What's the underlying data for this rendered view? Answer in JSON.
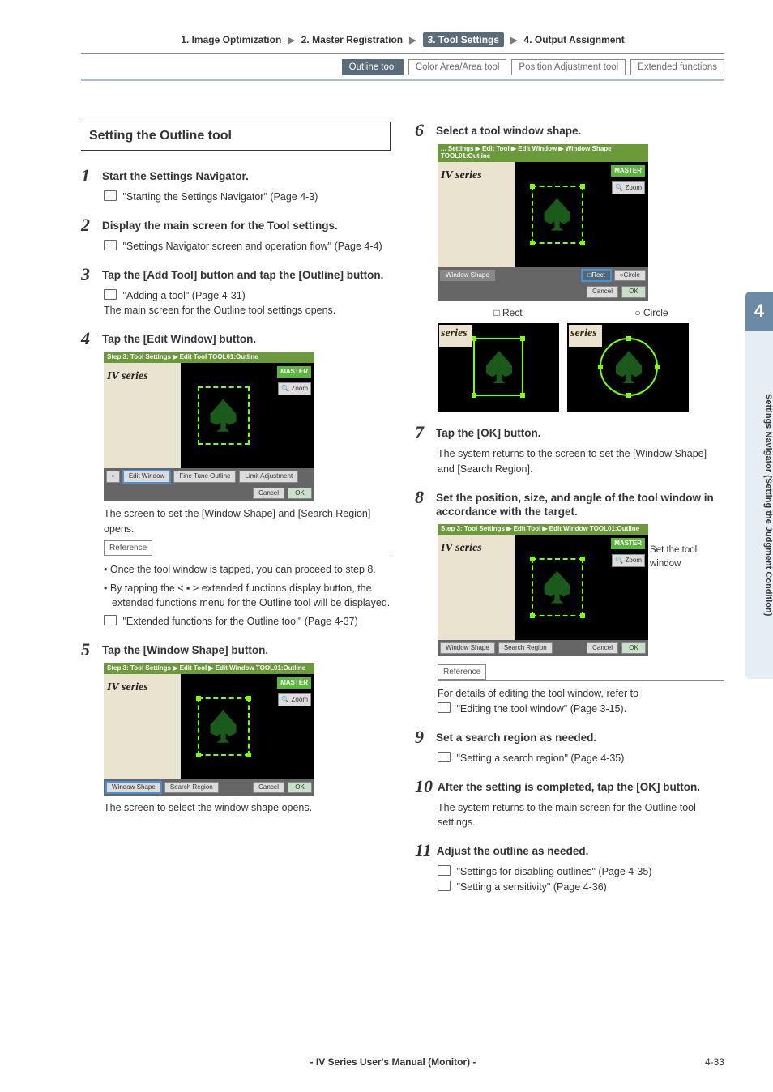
{
  "breadcrumb": {
    "items": [
      {
        "label": "1. Image Optimization"
      },
      {
        "label": "2. Master Registration"
      },
      {
        "label": "3. Tool Settings",
        "active": true
      },
      {
        "label": "4. Output Assignment"
      }
    ]
  },
  "subnav": {
    "items": [
      {
        "label": "Outline tool",
        "active": true
      },
      {
        "label": "Color Area/Area tool"
      },
      {
        "label": "Position Adjustment tool"
      },
      {
        "label": "Extended functions"
      }
    ]
  },
  "section_heading": "Setting the Outline tool",
  "steps": {
    "s1": {
      "num": "1",
      "title": "Start the Settings Navigator.",
      "ref": "\"Starting the Settings Navigator\" (Page 4-3)"
    },
    "s2": {
      "num": "2",
      "title": "Display the main screen for the Tool settings.",
      "ref": "\"Settings Navigator screen and operation flow\" (Page 4-4)"
    },
    "s3": {
      "num": "3",
      "title": "Tap the [Add Tool] button and tap the [Outline] button.",
      "ref": "\"Adding a tool\" (Page 4-31)",
      "desc": "The main screen for the Outline tool settings opens."
    },
    "s4": {
      "num": "4",
      "title": "Tap the [Edit Window] button.",
      "after": "The screen to set the [Window Shape] and [Search Region] opens.",
      "reference_label": "Reference",
      "bullets": [
        "Once the tool window is tapped, you can proceed to step 8.",
        "By tapping the < ▪ > extended functions display button, the extended functions menu for the Outline tool will be displayed."
      ],
      "ref2": "\"Extended functions for the Outline tool\" (Page 4-37)"
    },
    "s5": {
      "num": "5",
      "title": "Tap the [Window Shape] button.",
      "after": "The screen to select the window shape opens."
    },
    "s6": {
      "num": "6",
      "title": "Select a tool window shape.",
      "rect_label": "□ Rect",
      "circle_label": "○ Circle"
    },
    "s7": {
      "num": "7",
      "title": "Tap the [OK] button.",
      "desc": "The system returns to the screen to set the [Window Shape] and [Search Region]."
    },
    "s8": {
      "num": "8",
      "title": "Set the position, size, and angle of the tool window in accordance with the target.",
      "annotation": "Set the tool window",
      "reference_label": "Reference",
      "desc": "For details of editing the tool window, refer to",
      "ref": "\"Editing the tool window\" (Page 3-15)."
    },
    "s9": {
      "num": "9",
      "title": "Set a search region as needed.",
      "ref": "\"Setting a search region\" (Page 4-35)"
    },
    "s10": {
      "num": "10",
      "title": "After the setting is completed, tap the [OK] button.",
      "desc": "The system returns to the main screen for the Outline tool settings."
    },
    "s11": {
      "num": "11",
      "title": "Adjust the outline as needed.",
      "ref1": "\"Settings for disabling outlines\" (Page 4-35)",
      "ref2": "\"Setting a sensitivity\" (Page 4-36)"
    }
  },
  "screenshots": {
    "s4": {
      "topbar": "Step 3: Tool Settings ▶ Edit Tool\nTOOL01:Outline",
      "iv": "IV series",
      "master": "MASTER",
      "zoom": "🔍 Zoom",
      "bottom": [
        "Edit Window",
        "Fine Tune Outline",
        "Limit Adjustment"
      ],
      "cancel": "Cancel",
      "ok": "OK"
    },
    "s5": {
      "topbar": "Step 3: Tool Settings ▶ Edit Tool ▶ Edit Window\nTOOL01:Outline",
      "iv": "IV series",
      "master": "MASTER",
      "zoom": "🔍 Zoom",
      "bottom": [
        "Window Shape",
        "Search Region"
      ],
      "cancel": "Cancel",
      "ok": "OK"
    },
    "s6": {
      "topbar": "... Settings ▶ Edit Tool ▶ Edit Window ▶ Window Shape\nTOOL01:Outline",
      "iv": "IV series",
      "master": "MASTER",
      "zoom": "🔍 Zoom",
      "shape_label": "Window Shape",
      "rect": "□Rect",
      "circle": "○Circle",
      "cancel": "Cancel",
      "ok": "OK",
      "series_frag": "series"
    },
    "s8": {
      "topbar": "Step 3: Tool Settings ▶ Edit Tool ▶ Edit Window\nTOOL01:Outline",
      "iv": "IV series",
      "master": "MASTER",
      "zoom": "🔍 Zoom",
      "bottom": [
        "Window Shape",
        "Search Region"
      ],
      "cancel": "Cancel",
      "ok": "OK"
    }
  },
  "side_tab": {
    "num": "4",
    "text": "Settings Navigator (Setting the Judgment Condition)"
  },
  "footer": {
    "left": "",
    "center": "- IV Series User's Manual (Monitor) -",
    "right": "4-33"
  }
}
